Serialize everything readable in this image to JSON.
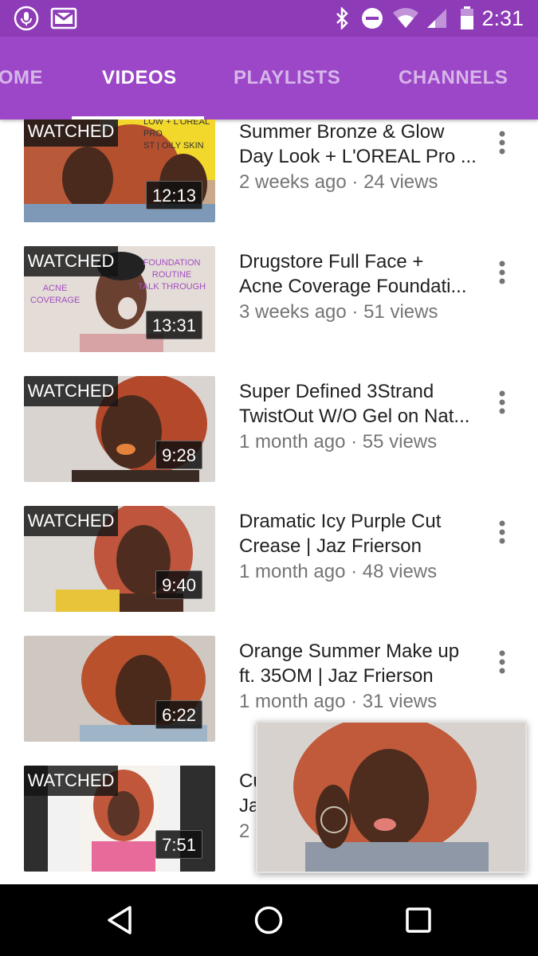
{
  "status_bar": {
    "time": "2:31",
    "icons": [
      "mic-icon",
      "gmail-icon",
      "bluetooth-icon",
      "do-not-disturb-icon",
      "wifi-icon",
      "signal-icon",
      "battery-icon"
    ]
  },
  "tabs": [
    {
      "label": "OME",
      "active": false
    },
    {
      "label": "VIDEOS",
      "active": true
    },
    {
      "label": "PLAYLISTS",
      "active": false
    },
    {
      "label": "CHANNELS",
      "active": false
    }
  ],
  "colors": {
    "status_bar": "#8e3bb8",
    "tab_bar": "#9b47c8",
    "title_text": "#212121",
    "meta_text": "#757575"
  },
  "videos": [
    {
      "title_line1": "Summer Bronze & Glow",
      "title_line2": "Day Look + L'OREAL Pro ...",
      "meta": "2 weeks ago · 24 views",
      "duration": "12:13",
      "watched": "WATCHED",
      "thumb_text": [
        "LOW + L'OREAL PRO",
        "ST | OILY SKIN"
      ]
    },
    {
      "title_line1": "Drugstore Full Face +",
      "title_line2": "Acne Coverage Foundati...",
      "meta": "3 weeks ago · 51 views",
      "duration": "13:31",
      "watched": "WATCHED",
      "thumb_text": [
        "FOUNDATION",
        "ROUTINE",
        "TALK THROUGH",
        "ACNE",
        "COVERAGE"
      ]
    },
    {
      "title_line1": "Super Defined 3Strand",
      "title_line2": "TwistOut W/O Gel on Nat...",
      "meta": "1 month ago · 55 views",
      "duration": "9:28",
      "watched": "WATCHED"
    },
    {
      "title_line1": "Dramatic Icy Purple Cut",
      "title_line2": "Crease | Jaz Frierson",
      "meta": "1 month ago · 48 views",
      "duration": "9:40",
      "watched": "WATCHED"
    },
    {
      "title_line1": "Orange Summer Make up",
      "title_line2": "ft. 35OM | Jaz Frierson",
      "meta": "1 month ago · 31 views",
      "duration": "6:22",
      "watched": ""
    },
    {
      "title_line1": "Cu",
      "title_line2": "Ja",
      "meta": "2",
      "duration": "7:51",
      "watched": "WATCHED"
    }
  ]
}
